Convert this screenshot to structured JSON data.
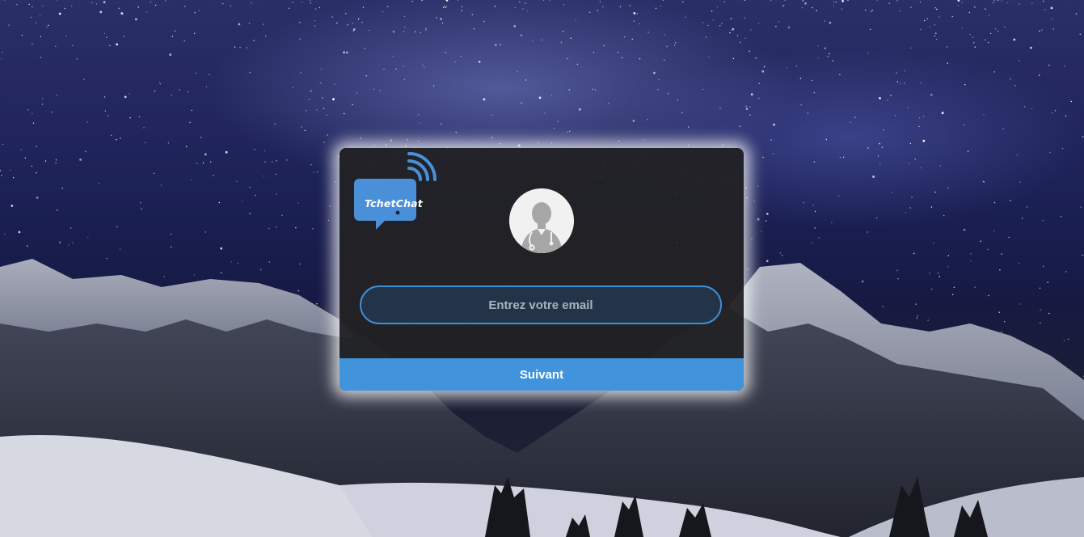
{
  "brand": {
    "logo_text": "TchetChat",
    "color": "#4a90d9"
  },
  "login": {
    "email_placeholder": "Entrez votre email",
    "email_value": "",
    "submit_label": "Suivant"
  },
  "colors": {
    "accent": "#4193dc",
    "card_background": "#222224",
    "input_border": "#3f8fd6"
  },
  "icons": {
    "logo": "chat-bubble-signal-icon",
    "avatar": "doctor-user-icon"
  }
}
